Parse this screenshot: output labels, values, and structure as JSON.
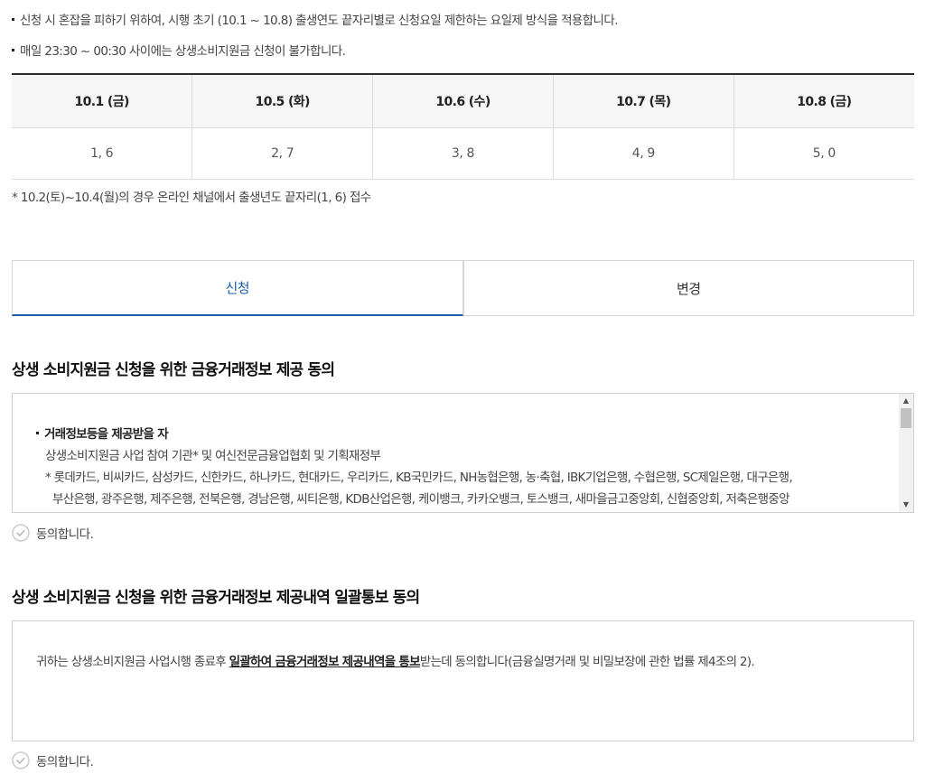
{
  "notices": [
    "신청 시 혼잡을 피하기 위하여, 시행 초기 (10.1 ~ 10.8) 출생연도 끝자리별로 신청요일 제한하는 요일제 방식을 적용합니다.",
    "매일 23:30 ~ 00:30 사이에는 상생소비지원금 신청이 불가합니다."
  ],
  "schedule": {
    "headers": [
      "10.1 (금)",
      "10.5 (화)",
      "10.6 (수)",
      "10.7 (목)",
      "10.8 (금)"
    ],
    "digits": [
      "1, 6",
      "2, 7",
      "3, 8",
      "4, 9",
      "5, 0"
    ]
  },
  "footnote": "* 10.2(토)~10.4(월)의 경우 온라인 채널에서 출생년도 끝자리(1, 6) 접수",
  "tabs": {
    "apply": "신청",
    "change": "변경"
  },
  "section1": {
    "title": "상생 소비지원금 신청을 위한 금융거래정보 제공 동의",
    "item_head": "거래정보등을 제공받을 자",
    "line1": "상생소비지원금 사업 참여 기관* 및 여신전문금융업협회 및 기획재정부",
    "line2": "* 롯데카드, 비씨카드, 삼성카드, 신한카드, 하나카드, 현대카드, 우리카드, KB국민카드, NH농협은행, 농·축협, IBK기업은행, 수협은행, SC제일은행, 대구은행,",
    "line3": "부산은행, 광주은행, 제주은행, 전북은행, 경남은행, 씨티은행, KDB산업은행, 케이뱅크, 카카오뱅크, 토스뱅크, 새마을금고중앙회, 신협중앙회, 저축은행중앙",
    "agree_label": "동의합니다."
  },
  "section2": {
    "title": "상생 소비지원금 신청을 위한 금융거래정보 제공내역 일괄통보 동의",
    "text_before": "귀하는 상생소비지원금 사업시행 종료후 ",
    "text_emphasis": "일괄하여 금융거래정보 제공내역을 통보",
    "text_after": "받는데 동의합니다(금융실명거래 및 비밀보장에 관한 법률 제4조의 2).",
    "agree_label": "동의합니다."
  },
  "icons": {
    "check": "check-circle-icon",
    "scroll_up": "scroll-up-arrow-icon",
    "scroll_down": "scroll-down-arrow-icon"
  },
  "colors": {
    "accent": "#1a5fa8",
    "table_header_bg": "#f6f6f6",
    "border": "#dcdcdc"
  }
}
